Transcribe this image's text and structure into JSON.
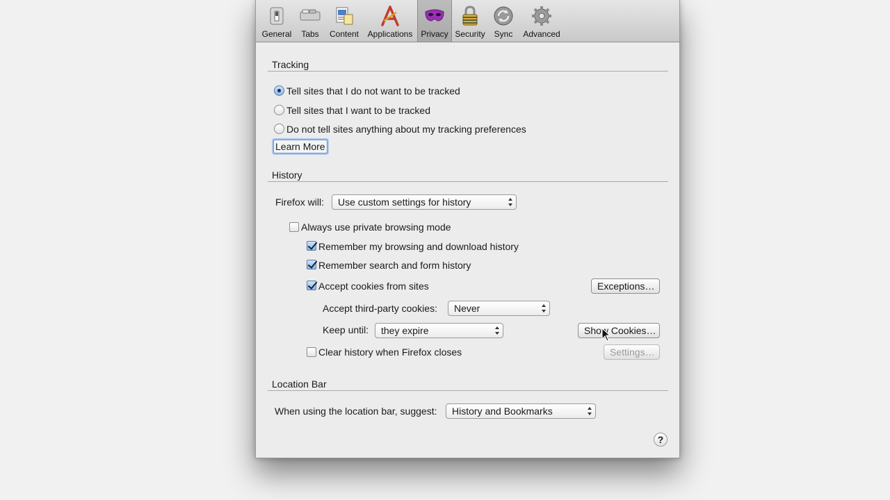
{
  "toolbar": {
    "items": [
      {
        "label": "General",
        "icon": "general-switch-icon",
        "selected": false
      },
      {
        "label": "Tabs",
        "icon": "tabs-icon",
        "selected": false
      },
      {
        "label": "Content",
        "icon": "content-icon",
        "selected": false
      },
      {
        "label": "Applications",
        "icon": "applications-icon",
        "selected": false
      },
      {
        "label": "Privacy",
        "icon": "privacy-mask-icon",
        "selected": true
      },
      {
        "label": "Security",
        "icon": "lock-icon",
        "selected": false
      },
      {
        "label": "Sync",
        "icon": "sync-icon",
        "selected": false
      },
      {
        "label": "Advanced",
        "icon": "gear-icon",
        "selected": false
      }
    ]
  },
  "tracking": {
    "title": "Tracking",
    "options": [
      {
        "label": "Tell sites that I do not want to be tracked",
        "selected": true
      },
      {
        "label": "Tell sites that I want to be tracked",
        "selected": false
      },
      {
        "label": "Do not tell sites anything about my tracking preferences",
        "selected": false
      }
    ],
    "learn_more": "Learn More"
  },
  "history": {
    "title": "History",
    "firefox_will_label": "Firefox will:",
    "firefox_will_value": "Use custom settings for history",
    "private_mode": {
      "label": "Always use private browsing mode",
      "checked": false
    },
    "remember_browsing": {
      "label": "Remember my browsing and download history",
      "checked": true
    },
    "remember_search": {
      "label": "Remember search and form history",
      "checked": true
    },
    "accept_cookies": {
      "label": "Accept cookies from sites",
      "checked": true
    },
    "exceptions_button": "Exceptions…",
    "third_party_label": "Accept third-party cookies:",
    "third_party_value": "Never",
    "keep_until_label": "Keep until:",
    "keep_until_value": "they expire",
    "show_cookies_button": "Show Cookies…",
    "clear_history": {
      "label": "Clear history when Firefox closes",
      "checked": false
    },
    "settings_button": "Settings…"
  },
  "location_bar": {
    "title": "Location Bar",
    "suggest_label": "When using the location bar, suggest:",
    "suggest_value": "History and Bookmarks"
  },
  "help_button": "?"
}
